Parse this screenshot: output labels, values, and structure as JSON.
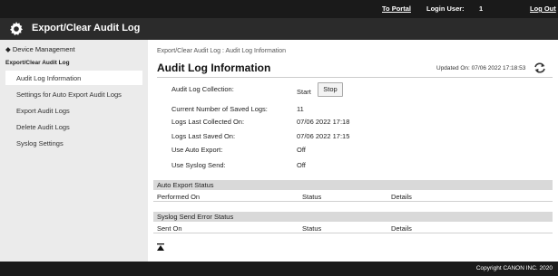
{
  "topbar": {
    "portal_link": "To Portal",
    "login_label": "Login User:",
    "login_user": "1",
    "logout_link": "Log Out"
  },
  "titlebar": {
    "title": "Export/Clear Audit Log",
    "icon": "gear-icon"
  },
  "sidebar": {
    "back_link": "◆ Device Management",
    "section": "Export/Clear Audit Log",
    "items": [
      {
        "label": "Audit Log Information",
        "active": true
      },
      {
        "label": "Settings for Auto Export Audit Logs"
      },
      {
        "label": "Export Audit Logs"
      },
      {
        "label": "Delete Audit Logs"
      },
      {
        "label": "Syslog Settings"
      }
    ]
  },
  "main": {
    "breadcrumb": "Export/Clear Audit Log : Audit Log Information",
    "title": "Audit Log Information",
    "updated": "Updated On: 07/06 2022 17:18:53",
    "rows": [
      {
        "label": "Audit Log Collection:",
        "value": "Start"
      },
      {
        "label": "Current Number of Saved Logs:",
        "value": "11"
      },
      {
        "label": "Logs Last Collected On:",
        "value": "07/06 2022 17:18"
      },
      {
        "label": "Logs Last Saved On:",
        "value": "07/06 2022 17:15"
      },
      {
        "label": "Use Auto Export:",
        "value": "Off"
      },
      {
        "label": "Use Syslog Send:",
        "value": "Off"
      }
    ],
    "stop_button": "Stop",
    "auto_export": {
      "heading": "Auto Export Status",
      "columns": [
        "Performed On",
        "Status",
        "Details"
      ]
    },
    "syslog_error": {
      "heading": "Syslog Send Error Status",
      "columns": [
        "Sent On",
        "Status",
        "Details"
      ]
    }
  },
  "footer": {
    "copyright": "Copyright CANON INC. 2020"
  }
}
